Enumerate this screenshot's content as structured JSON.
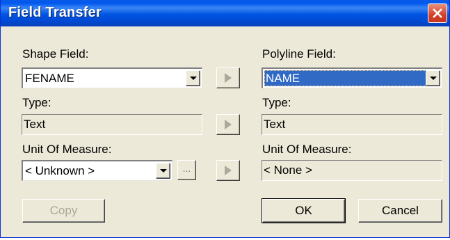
{
  "window": {
    "title": "Field Transfer"
  },
  "shape": {
    "field_label": "Shape Field:",
    "field_value": "FENAME",
    "type_label": "Type:",
    "type_value": "Text",
    "unit_label": "Unit Of Measure:",
    "unit_value": "< Unknown >",
    "browse_label": "..."
  },
  "polyline": {
    "field_label": "Polyline Field:",
    "field_value": "NAME",
    "type_label": "Type:",
    "type_value": "Text",
    "unit_label": "Unit Of Measure:",
    "unit_value": "< None >"
  },
  "buttons": {
    "copy": "Copy",
    "ok": "OK",
    "cancel": "Cancel"
  },
  "icons": {
    "close": "close-icon",
    "dropdown": "chevron-down-icon",
    "transfer": "play-right-icon"
  },
  "colors": {
    "titlebar": "#0054e3",
    "selection": "#316ac5",
    "dialog_bg": "#ece9d8",
    "close": "#d4402a"
  }
}
